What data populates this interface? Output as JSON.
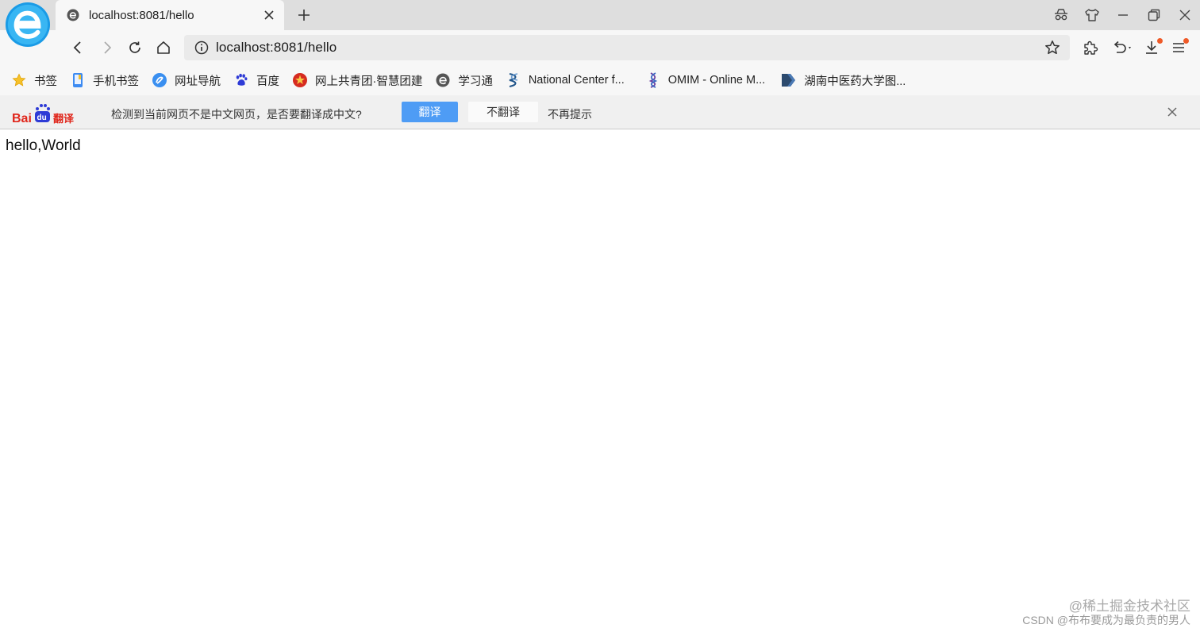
{
  "window": {
    "tab_title": "localhost:8081/hello"
  },
  "toolbar": {
    "url": "localhost:8081/hello"
  },
  "bookmarks": [
    {
      "label": "书签",
      "icon": "star-icon"
    },
    {
      "label": "手机书签",
      "icon": "phone-icon"
    },
    {
      "label": "网址导航",
      "icon": "nav-globe-icon"
    },
    {
      "label": "百度",
      "icon": "baidu-paw-icon"
    },
    {
      "label": "网上共青团·智慧团建",
      "icon": "youth-league-icon"
    },
    {
      "label": "学习通",
      "icon": "xuexitong-icon"
    },
    {
      "label": "National Center f...",
      "icon": "ncbi-icon"
    },
    {
      "label": "OMIM - Online M...",
      "icon": "dna-icon"
    },
    {
      "label": "湖南中医药大学图...",
      "icon": "library-icon"
    }
  ],
  "translate_bar": {
    "logo_text": "Bai du 翻译",
    "message": "检测到当前网页不是中文网页，是否要翻译成中文?",
    "translate_button": "翻译",
    "no_translate_button": "不翻译",
    "never_link": "不再提示"
  },
  "page": {
    "body_text": "hello,World"
  },
  "watermark": {
    "line1": "@稀土掘金技术社区",
    "line2": "CSDN @布布要成为最负责的男人"
  },
  "colors": {
    "accent": "#4e9cf5",
    "notification_dot": "#ef5a28"
  }
}
